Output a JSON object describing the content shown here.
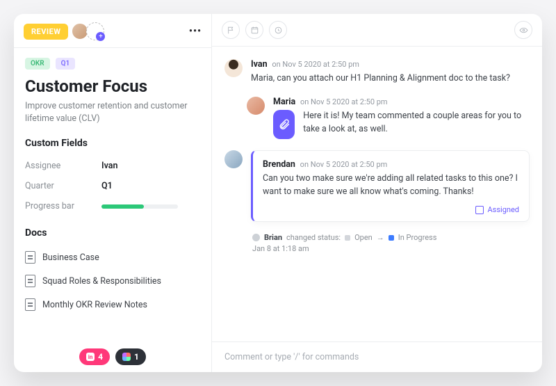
{
  "header": {
    "status_label": "REVIEW"
  },
  "tags": {
    "okr": "OKR",
    "q1": "Q1"
  },
  "title": "Customer Focus",
  "subtitle": "Improve customer retention and customer lifetime value (CLV)",
  "custom_fields": {
    "heading": "Custom Fields",
    "assignee_label": "Assignee",
    "assignee_value": "Ivan",
    "quarter_label": "Quarter",
    "quarter_value": "Q1",
    "progress_label": "Progress bar"
  },
  "docs": {
    "heading": "Docs",
    "items": [
      "Business Case",
      "Squad Roles & Responsibilities",
      "Monthly OKR Review Notes"
    ]
  },
  "bottom": {
    "pink_count": "4",
    "dark_count": "1"
  },
  "messages": {
    "ivan": {
      "name": "Ivan",
      "time": "on Nov 5 2020 at 2:50 pm",
      "text": "Maria, can you attach our H1 Planning & Alignment doc to the task?"
    },
    "maria": {
      "name": "Maria",
      "time": "on Nov 5 2020 at 2:50 pm",
      "text": "Here it is! My team commented a couple areas for you to take a look at, as well."
    },
    "brendan": {
      "name": "Brendan",
      "time": "on Nov 5 2020 at 2:50 pm",
      "text": "Can you two make sure we're adding all related tasks to this one? I want to make sure we all know what's coming. Thanks!",
      "assigned_label": "Assigned"
    }
  },
  "status_change": {
    "actor": "Brian",
    "verb": "changed status:",
    "from": "Open",
    "to": "In Progress",
    "arrow": "→",
    "time": "Jan 8 at 1:18 am"
  },
  "composer": {
    "placeholder": "Comment or type '/' for commands"
  }
}
